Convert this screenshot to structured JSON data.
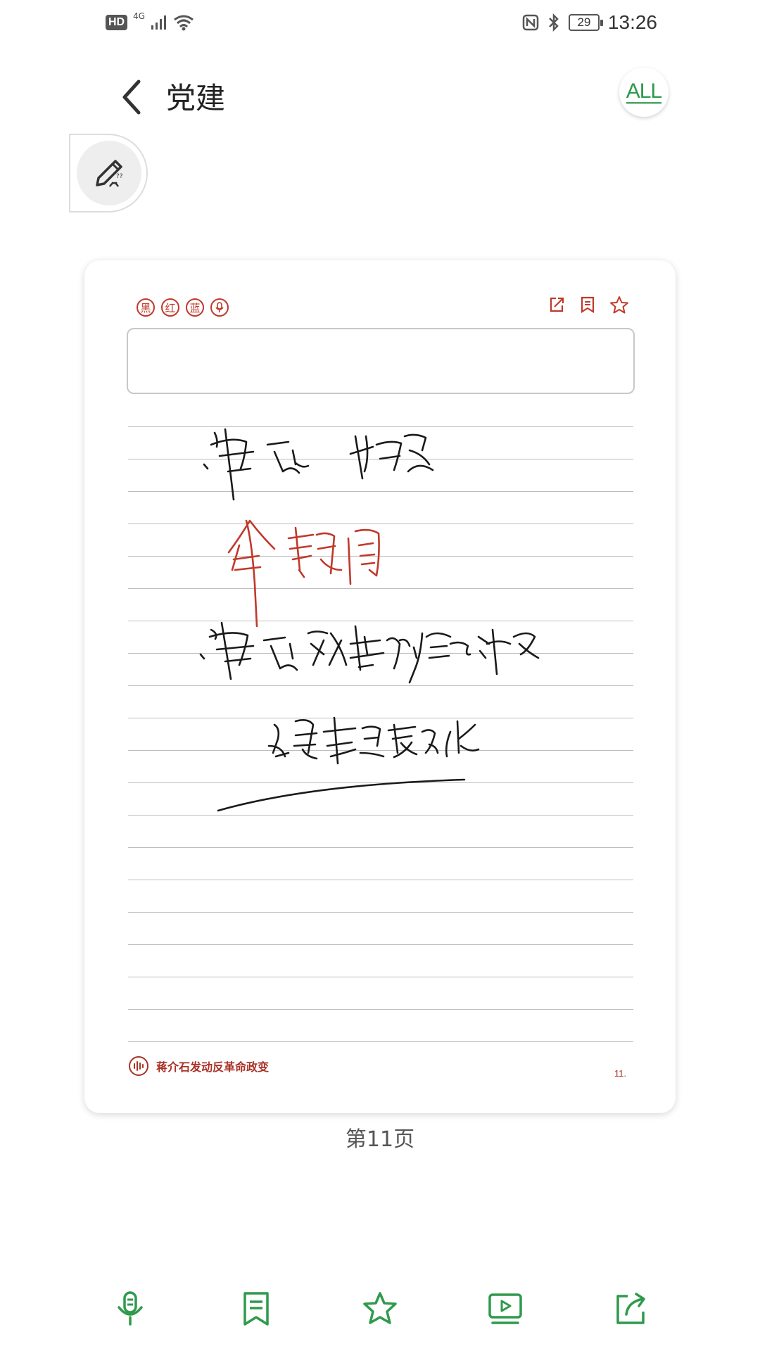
{
  "status_bar": {
    "network_badge": "HD",
    "network_type": "4G",
    "battery_level": "29",
    "time": "13:26"
  },
  "header": {
    "title": "党建",
    "all_label": "ALL"
  },
  "note": {
    "color_tools": [
      "黑",
      "红",
      "蓝"
    ],
    "audio_title": "蒋介石发动反革命政变",
    "page_number_small": "11.",
    "ink_colors": {
      "black": "#1a1a1a",
      "red": "#c0392b"
    }
  },
  "page_label": "第11页",
  "colors": {
    "accent_green": "#2f9a4c",
    "accent_red": "#c0392b"
  },
  "toolbar": {
    "icons": [
      "microphone-icon",
      "bookmark-icon",
      "star-icon",
      "video-icon",
      "share-icon"
    ]
  }
}
